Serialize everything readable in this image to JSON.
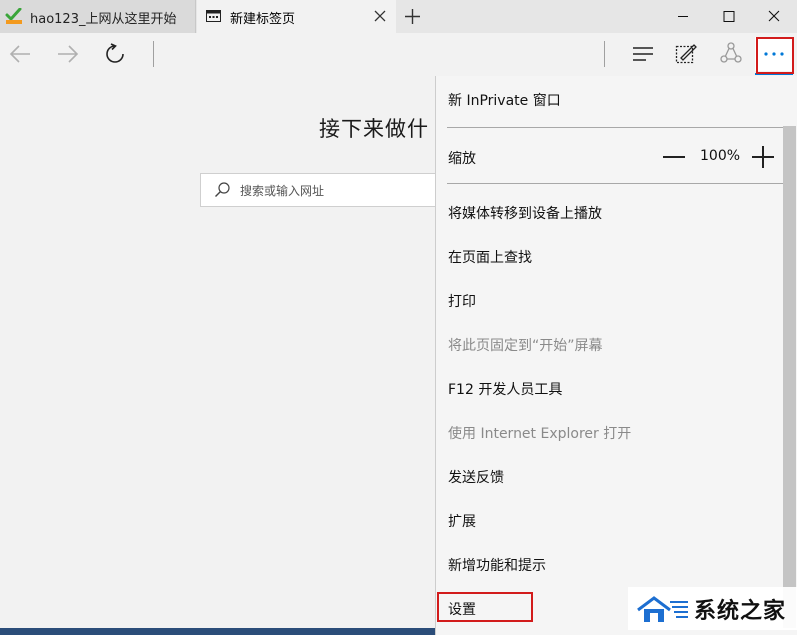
{
  "tabs": [
    {
      "title": "hao123_上网从这里开始"
    },
    {
      "title": "新建标签页"
    }
  ],
  "page": {
    "headline": "接下来做什",
    "search_placeholder": "搜索或输入网址"
  },
  "menu": {
    "inprivate": "新 InPrivate 窗口",
    "zoom_label": "缩放",
    "zoom_value": "100%",
    "cast": "将媒体转移到设备上播放",
    "find": "在页面上查找",
    "print": "打印",
    "pin": "将此页固定到“开始”屏幕",
    "devtools": "F12 开发人员工具",
    "open_ie": "使用 Internet Explorer 打开",
    "feedback": "发送反馈",
    "extensions": "扩展",
    "whats_new": "新增功能和提示",
    "settings": "设置"
  },
  "watermark": {
    "text": "系统之家"
  },
  "colors": {
    "highlight": "#d21b1b",
    "accent": "#0078d7"
  }
}
